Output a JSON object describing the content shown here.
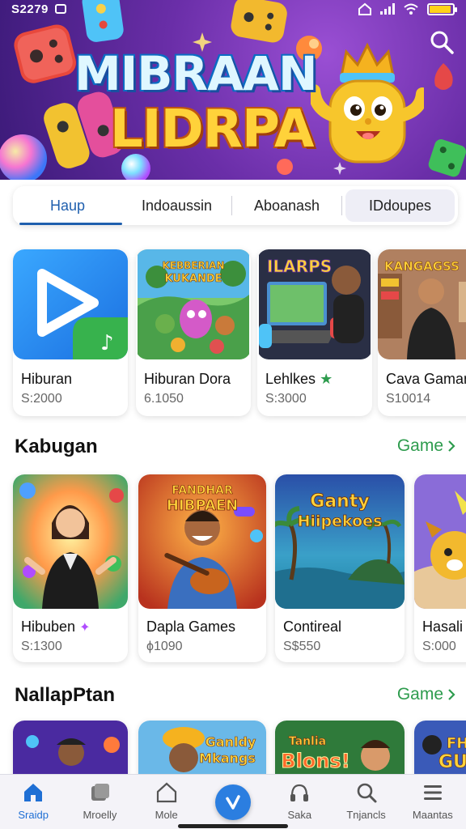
{
  "status_bar": {
    "time": "S2279"
  },
  "banner": {
    "title_line1": "MIBRAAN",
    "title_line2": "LIDRPA"
  },
  "tabs": [
    {
      "label": "Haup",
      "active": true
    },
    {
      "label": "Indoaussin",
      "active": false
    },
    {
      "label": "Aboanash",
      "active": false
    },
    {
      "label": "IDdoupes",
      "active": false
    }
  ],
  "featured": [
    {
      "title": "Hiburan",
      "price": "S:2000",
      "thumb": "play-app-icon"
    },
    {
      "title": "Hiburan Dora",
      "price": "6.1050",
      "thumb": "cartoon-characters",
      "thumb_text": "KEBBERIAN KUKANDE"
    },
    {
      "title": "Lehlkes",
      "price": "S:3000",
      "thumb": "gamer-laptop",
      "thumb_text": "ILARPS",
      "badge": "star-icon"
    },
    {
      "title": "Cava Gaman",
      "price": "S10014",
      "thumb": "person-room",
      "thumb_text": "KANGAGSS"
    }
  ],
  "section_kabugan": {
    "heading": "Kabugan",
    "more_label": "Game",
    "items": [
      {
        "title": "Hibuben",
        "price": "S:1300",
        "thumb": "woman-character",
        "badge": "sparkle-icon"
      },
      {
        "title": "Dapla Games",
        "price": "ϕ1090",
        "thumb": "guitar-man",
        "thumb_text": "HIBPAEN"
      },
      {
        "title": "Contireal",
        "price": "S$550",
        "thumb": "island-scene",
        "thumb_text": "Ganty Hiipekoes"
      },
      {
        "title": "Hasali",
        "price": "S:000",
        "thumb": "cartoon-dog"
      }
    ]
  },
  "section_nallap": {
    "heading": "NallapPtan",
    "more_label": "Game",
    "items": [
      {
        "title": "",
        "price": "",
        "thumb": "man-cap-purple"
      },
      {
        "title": "",
        "price": "",
        "thumb": "chef-man",
        "thumb_text": "Ganldy Mkangs"
      },
      {
        "title": "",
        "price": "",
        "thumb": "blons-man",
        "thumb_text": "Blons!"
      },
      {
        "title": "",
        "price": "",
        "thumb": "fh-gu-card",
        "thumb_text": "FH GU"
      }
    ]
  },
  "bottom_nav": [
    {
      "label": "Sraidp",
      "icon": "home-icon",
      "active": true
    },
    {
      "label": "Mroelly",
      "icon": "cards-icon",
      "active": false
    },
    {
      "label": "Mole",
      "icon": "house-outline-icon",
      "active": false
    },
    {
      "label": "",
      "icon": "center-action-icon",
      "active": false
    },
    {
      "label": "Saka",
      "icon": "headphones-icon",
      "active": false
    },
    {
      "label": "Tnjancls",
      "icon": "search-icon",
      "active": false
    },
    {
      "label": "Maantas",
      "icon": "menu-icon",
      "active": false
    }
  ],
  "colors": {
    "accent": "#1f5fae",
    "more_link": "#2e9c4e",
    "banner_bg": "#6a2ea8",
    "title_yellow": "#ffd23a"
  }
}
